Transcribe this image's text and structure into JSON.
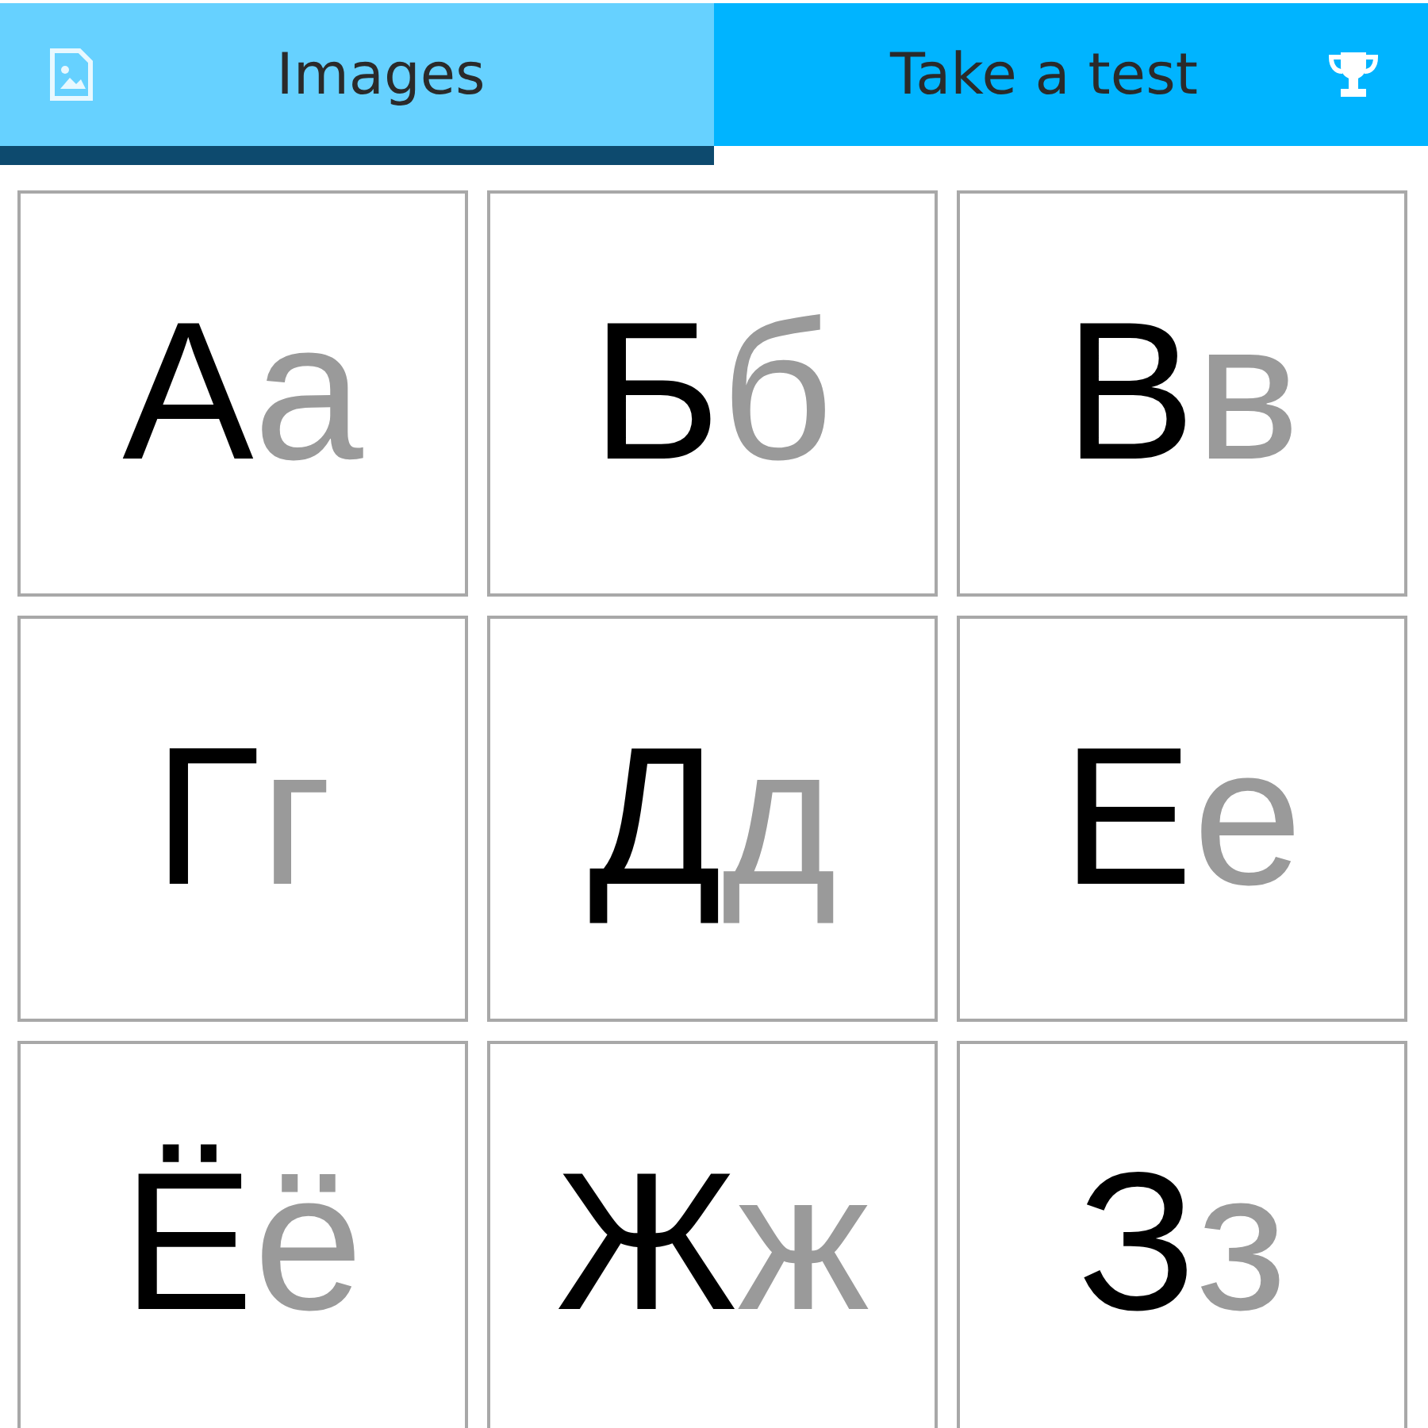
{
  "tabs": [
    {
      "label": "Images",
      "kind": "image",
      "selected": true
    },
    {
      "label": "Take a test",
      "kind": "trophy",
      "selected": false
    }
  ],
  "letters": [
    {
      "upper": "А",
      "lower": "а"
    },
    {
      "upper": "Б",
      "lower": "б"
    },
    {
      "upper": "В",
      "lower": "в"
    },
    {
      "upper": "Г",
      "lower": "г"
    },
    {
      "upper": "Д",
      "lower": "д"
    },
    {
      "upper": "Е",
      "lower": "е"
    },
    {
      "upper": "Ё",
      "lower": "ё"
    },
    {
      "upper": "Ж",
      "lower": "ж"
    },
    {
      "upper": "З",
      "lower": "з"
    }
  ]
}
